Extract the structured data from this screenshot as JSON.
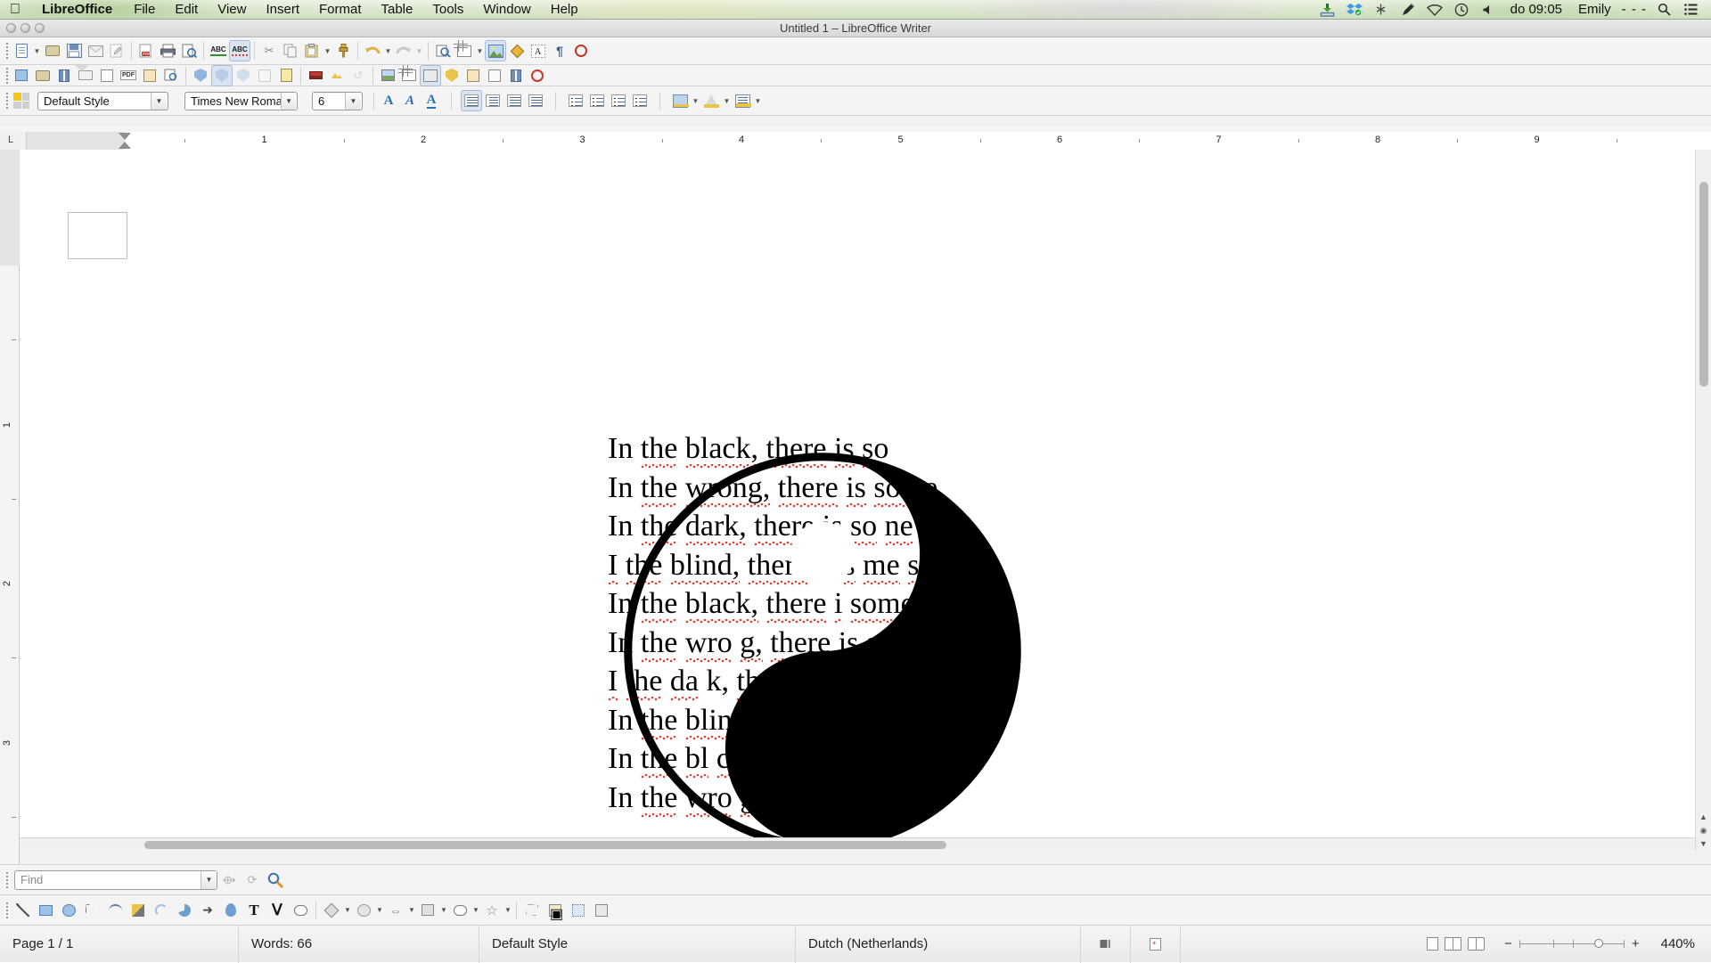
{
  "menubar": {
    "apple_icon": "apple-logo",
    "items": [
      "LibreOffice",
      "File",
      "Edit",
      "View",
      "Insert",
      "Format",
      "Table",
      "Tools",
      "Window",
      "Help"
    ],
    "status_icons": [
      "download-icon",
      "dropbox-icon",
      "bluetooth-icon",
      "pen-tablet-icon",
      "wifi-icon",
      "time-machine-icon",
      "volume-icon"
    ],
    "clock": "do 09:05",
    "user": "Emily",
    "user_dots": "- - -",
    "search_icon": "search-icon",
    "notification_icon": "notification-center-icon"
  },
  "window": {
    "title": "Untitled 1 – LibreOffice Writer",
    "controls": [
      "close-button",
      "minimize-button",
      "zoom-button"
    ]
  },
  "toolbars": {
    "standard": [
      {
        "name": "new-document",
        "icon": "new-doc-icon",
        "dropdown": true
      },
      {
        "name": "open-document",
        "icon": "folder-open-icon"
      },
      {
        "name": "save-document",
        "icon": "save-icon"
      },
      {
        "name": "email-document",
        "icon": "envelope-icon"
      },
      {
        "name": "edit-mode",
        "icon": "edit-pencil-icon"
      },
      {
        "name": "export-pdf",
        "icon": "pdf-export-icon"
      },
      {
        "name": "print-file",
        "icon": "printer-icon"
      },
      {
        "name": "print-preview",
        "icon": "print-preview-icon"
      },
      {
        "name": "spelling",
        "icon": "abc-check-icon"
      },
      {
        "name": "autospellcheck",
        "icon": "abc-wave-icon",
        "active": true
      },
      {
        "name": "cut",
        "icon": "scissors-icon"
      },
      {
        "name": "copy",
        "icon": "copy-icon"
      },
      {
        "name": "paste",
        "icon": "clipboard-icon",
        "dropdown": true
      },
      {
        "name": "clone-formatting",
        "icon": "paintbrush-icon"
      },
      {
        "name": "undo",
        "icon": "undo-icon",
        "dropdown": true
      },
      {
        "name": "redo",
        "icon": "redo-icon",
        "dropdown": true
      },
      {
        "name": "find-replace",
        "icon": "find-replace-icon"
      },
      {
        "name": "insert-table",
        "icon": "table-icon",
        "dropdown": true
      },
      {
        "name": "insert-image",
        "icon": "image-icon",
        "active": true
      },
      {
        "name": "insert-chart",
        "icon": "chart-icon"
      },
      {
        "name": "insert-textbox",
        "icon": "textbox-icon"
      },
      {
        "name": "formatting-marks",
        "icon": "pilcrow-icon"
      },
      {
        "name": "insert-special-char",
        "icon": "special-char-icon"
      }
    ],
    "standard_row2": [
      {
        "name": "insert-field",
        "icon": "field-icon"
      },
      {
        "name": "insert-footnote",
        "icon": "footnote-icon"
      },
      {
        "name": "insert-bookmark",
        "icon": "bookmark-icon"
      },
      {
        "name": "insert-envelope",
        "icon": "envelope2-icon"
      },
      {
        "name": "page-break",
        "icon": "page-break-icon"
      },
      {
        "name": "export-pdf2",
        "icon": "pdf-icon"
      },
      {
        "name": "insert-frame",
        "icon": "frame-icon"
      },
      {
        "name": "insert-hyperlink",
        "icon": "hyperlink-icon"
      },
      {
        "name": "track-changes",
        "icon": "shield-icon"
      },
      {
        "name": "track-changes-show",
        "icon": "shield-alt-icon",
        "active": true
      },
      {
        "name": "accept-change",
        "icon": "accept-icon"
      },
      {
        "name": "reject-change",
        "icon": "reject-icon"
      },
      {
        "name": "comment",
        "icon": "comment-icon"
      },
      {
        "name": "color-bar",
        "icon": "color-bar-icon"
      },
      {
        "name": "gallery",
        "icon": "gallery-icon"
      },
      {
        "name": "navigator",
        "icon": "navigator-icon"
      },
      {
        "name": "data-sources",
        "icon": "data-sources-icon"
      },
      {
        "name": "table-grid",
        "icon": "table-grid-icon"
      },
      {
        "name": "image-filter",
        "icon": "image-filter-icon"
      },
      {
        "name": "anchor",
        "icon": "anchor-icon"
      },
      {
        "name": "wrap-left",
        "icon": "wrap-left-icon"
      },
      {
        "name": "wrap-right",
        "icon": "wrap-right-icon"
      },
      {
        "name": "align-bar",
        "icon": "align-bar-icon"
      },
      {
        "name": "no-fill",
        "icon": "no-fill-icon"
      }
    ],
    "formatting": {
      "style_box_icon": "paragraph-style-icon",
      "paragraph_style": "Default Style",
      "font_name": "Times New Roma",
      "font_size": "6",
      "bold_icon": "bold-icon",
      "italic_icon": "italic-icon",
      "underline_icon": "underline-icon",
      "align_left_icon": "align-left-icon",
      "align_center_icon": "align-center-icon",
      "align_right_icon": "align-right-icon",
      "align_justify_icon": "align-justify-icon",
      "ordered_list_icon": "ordered-list-icon",
      "unordered_list_icon": "unordered-list-icon",
      "decrease_indent_icon": "decrease-indent-icon",
      "increase_indent_icon": "increase-indent-icon",
      "highlight_icon": "character-highlighting-icon",
      "font_color_icon": "font-color-icon",
      "paragraph_bg_icon": "paragraph-background-icon"
    }
  },
  "rulers": {
    "horizontal_marks": [
      "1",
      "2",
      "3",
      "4",
      "5",
      "6",
      "7",
      "8",
      "9"
    ],
    "vertical_marks": [
      "1",
      "2",
      "3"
    ],
    "corner_icon": "ruler-corner-icon"
  },
  "document": {
    "lines": [
      "In the black, there is so",
      "In the wrong, there is some",
      "In the dark, there is so ne lig",
      "I the blind, there is s me sig",
      "In the black, there i  some wh",
      "In the wro g, there is some rig",
      "I the da k, there is some ligh",
      "In the blind, th ere is some si",
      "In the bl ck, there is some",
      "In the  wro g, there is so"
    ],
    "graphic": "yin-yang-image"
  },
  "findbar": {
    "placeholder": "Find",
    "value": "",
    "dropdown_icon": "chevron-down-icon",
    "find_next_icon": "find-next-icon",
    "find_prev_icon": "find-previous-icon",
    "find_replace_icon": "find-and-replace-icon"
  },
  "drawbar": [
    {
      "name": "line-tool",
      "icon": "line-icon"
    },
    {
      "name": "rectangle-tool",
      "icon": "rectangle-icon"
    },
    {
      "name": "ellipse-tool",
      "icon": "ellipse-icon"
    },
    {
      "name": "polygon-tool",
      "icon": "polygon-icon"
    },
    {
      "name": "curve-tool",
      "icon": "curve-icon"
    },
    {
      "name": "freeform-line-tool",
      "icon": "freeform-line-icon"
    },
    {
      "name": "arc-tool",
      "icon": "arc-icon"
    },
    {
      "name": "ellipse-pie-tool",
      "icon": "ellipse-pie-icon"
    },
    {
      "name": "select-tool",
      "icon": "arrow-cursor-icon"
    },
    {
      "name": "fill-tool",
      "icon": "water-drop-icon"
    },
    {
      "name": "text-box-tool",
      "icon": "text-icon"
    },
    {
      "name": "vertical-text-tool",
      "icon": "vertical-text-icon"
    },
    {
      "name": "callout-tool",
      "icon": "callout-icon"
    },
    {
      "name": "basic-shapes",
      "icon": "basic-shapes-icon",
      "dropdown": true
    },
    {
      "name": "symbol-shapes",
      "icon": "symbol-shapes-icon",
      "dropdown": true
    },
    {
      "name": "block-arrows",
      "icon": "block-arrows-icon",
      "dropdown": true
    },
    {
      "name": "flowchart-shapes",
      "icon": "flowchart-icon",
      "dropdown": true
    },
    {
      "name": "callout-shapes",
      "icon": "callout-shapes-icon",
      "dropdown": true
    },
    {
      "name": "stars-shapes",
      "icon": "stars-icon",
      "dropdown": true
    },
    {
      "name": "3d-objects",
      "icon": "three-d-objects-icon"
    },
    {
      "name": "gallery-tool",
      "icon": "gallery-icon"
    },
    {
      "name": "fontwork-tool",
      "icon": "fontwork-icon"
    },
    {
      "name": "extrusion-tool",
      "icon": "extrusion-icon"
    }
  ],
  "statusbar": {
    "page": "Page 1 / 1",
    "words": "Words: 66",
    "style": "Default Style",
    "language": "Dutch (Netherlands)",
    "selection_mode_icon": "selection-mode-icon",
    "modified_icon": "document-modified-icon",
    "view_single_icon": "single-page-view-icon",
    "view_multi_icon": "multi-page-view-icon",
    "view_book_icon": "book-view-icon",
    "zoom_minus": "−",
    "zoom_plus": "+",
    "zoom": "440%"
  },
  "colors": {
    "accent": "#2f6fb3",
    "spellcheck": "#e03b2f",
    "menubar_bg": "#dfe9d2",
    "toolbar_bg": "#f4f4f4"
  }
}
